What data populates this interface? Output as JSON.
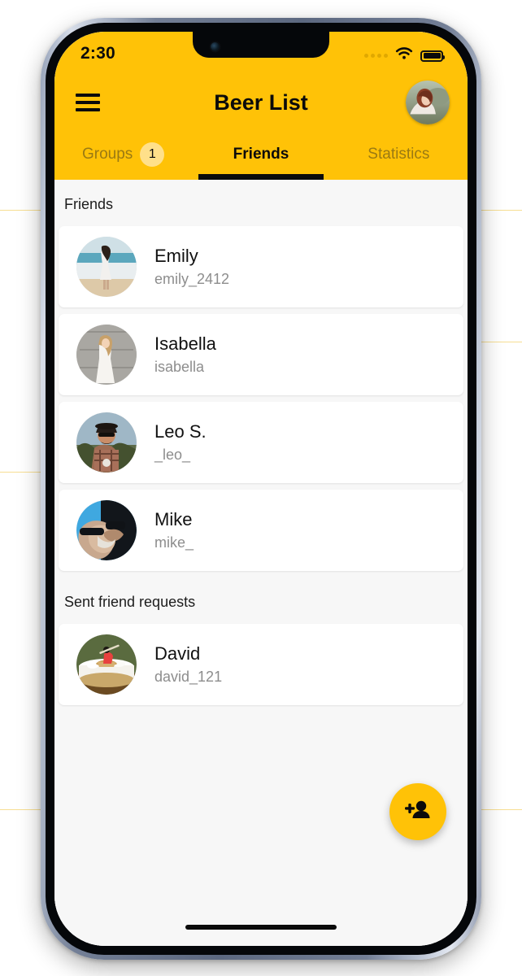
{
  "status_bar": {
    "time": "2:30",
    "signal_icon": "signal-dots-icon",
    "wifi_icon": "wifi-icon",
    "battery_icon": "battery-full-icon"
  },
  "header": {
    "menu_icon": "hamburger-menu-icon",
    "title": "Beer List",
    "avatar_name": "user-profile-avatar"
  },
  "tabs": [
    {
      "label": "Groups",
      "badge": "1",
      "active": false
    },
    {
      "label": "Friends",
      "badge": "",
      "active": true
    },
    {
      "label": "Statistics",
      "badge": "",
      "active": false
    }
  ],
  "sections": [
    {
      "title": "Friends",
      "items": [
        {
          "name": "Emily",
          "handle": "emily_2412"
        },
        {
          "name": "Isabella",
          "handle": "isabella"
        },
        {
          "name": "Leo S.",
          "handle": "_leo_"
        },
        {
          "name": "Mike",
          "handle": "mike_"
        }
      ]
    },
    {
      "title": "Sent friend requests",
      "items": [
        {
          "name": "David",
          "handle": "david_121"
        }
      ]
    }
  ],
  "fab": {
    "icon": "person-add-icon",
    "label": "Add friend"
  },
  "colors": {
    "accent": "#ffc207",
    "badge": "#ffe08a",
    "page_background": "#f7f7f7",
    "card": "#ffffff",
    "text_primary": "#111111",
    "text_muted": "#8d8d8d",
    "tab_inactive": "#9a7a13"
  }
}
